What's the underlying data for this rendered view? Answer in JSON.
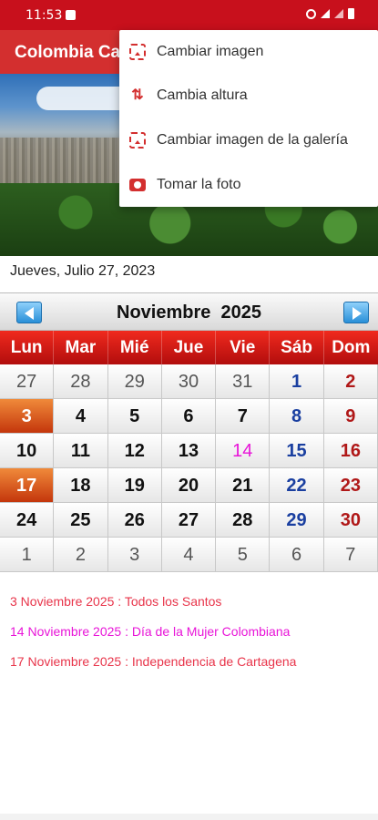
{
  "status_bar": {
    "time": "11:53"
  },
  "app_bar": {
    "title": "Colombia Calendario"
  },
  "menu": {
    "items": [
      {
        "label": "Cambiar imagen",
        "icon": "image-edit-icon"
      },
      {
        "label": "Cambia altura",
        "icon": "height-arrows-icon"
      },
      {
        "label": "Cambiar imagen de la galería",
        "icon": "gallery-image-icon"
      },
      {
        "label": "Tomar la foto",
        "icon": "camera-icon"
      }
    ]
  },
  "current_date": "Jueves, Julio 27, 2023",
  "calendar": {
    "month_title": "Noviembre  2025",
    "weekdays": [
      "Lun",
      "Mar",
      "Mié",
      "Jue",
      "Vie",
      "Sáb",
      "Dom"
    ],
    "weeks": [
      [
        "27",
        "28",
        "29",
        "30",
        "31",
        "1",
        "2"
      ],
      [
        "3",
        "4",
        "5",
        "6",
        "7",
        "8",
        "9"
      ],
      [
        "10",
        "11",
        "12",
        "13",
        "14",
        "15",
        "16"
      ],
      [
        "17",
        "18",
        "19",
        "20",
        "21",
        "22",
        "23"
      ],
      [
        "24",
        "25",
        "26",
        "27",
        "28",
        "29",
        "30"
      ],
      [
        "1",
        "2",
        "3",
        "4",
        "5",
        "6",
        "7"
      ]
    ]
  },
  "events": [
    {
      "text": "3 Noviembre 2025 : Todos los Santos",
      "color": "#e8344a"
    },
    {
      "text": "14 Noviembre 2025 : Día de la Mujer Colombiana",
      "color": "#e815d8"
    },
    {
      "text": "17 Noviembre 2025 : Independencia de Cartagena",
      "color": "#e8344a"
    }
  ],
  "colors": {
    "primary": "#d32f2f",
    "status_bar": "#c8101c",
    "saturday": "#1a3fa0",
    "sunday": "#b01818",
    "holiday_cell": "#e06a22",
    "festivity": "#e815d8"
  }
}
